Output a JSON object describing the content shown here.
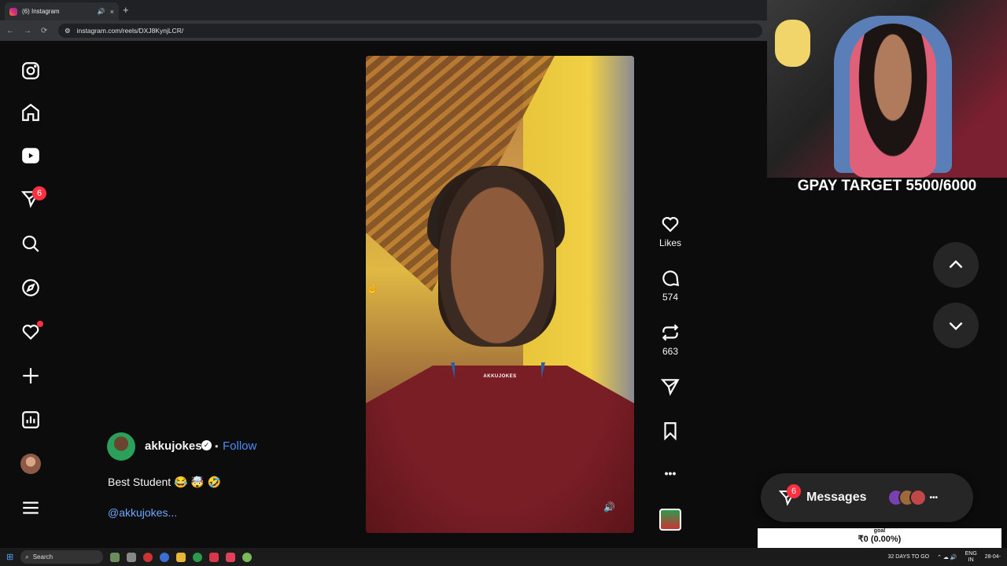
{
  "browser": {
    "tab_title": "(6) Instagram",
    "url": "instagram.com/reels/DXJ8KynjLCR/",
    "new_tab": "+",
    "tab_close": "×",
    "tab_audio": "🔊"
  },
  "sidebar": {
    "messages_badge": "6"
  },
  "reel": {
    "watermark": "AKKUJOKES",
    "volume_icon": "🔊"
  },
  "actions": {
    "likes_label": "Likes",
    "comments_count": "574",
    "reposts_count": "663",
    "more": "•••"
  },
  "caption": {
    "username": "akkujokes",
    "verified": "✓",
    "separator": "•",
    "follow_label": "Follow",
    "text": "Best Student 😂 🤯 🤣",
    "mention": "@akkujokes..."
  },
  "stream_overlay": {
    "gpay_target": "GPAY TARGET 5500/6000",
    "goal_label": "goal",
    "goal_value": "₹0 (0.00%)"
  },
  "messages": {
    "label": "Messages",
    "badge": "6",
    "more": "•••"
  },
  "taskbar": {
    "search": "Search",
    "weather": "32 DAYS TO GO",
    "lang": "ENG",
    "region": "IN",
    "date": "28-04-"
  },
  "colors": {
    "accent_blue": "#4b8cf7",
    "badge_red": "#ff3040",
    "background": "#0c0c0c"
  }
}
